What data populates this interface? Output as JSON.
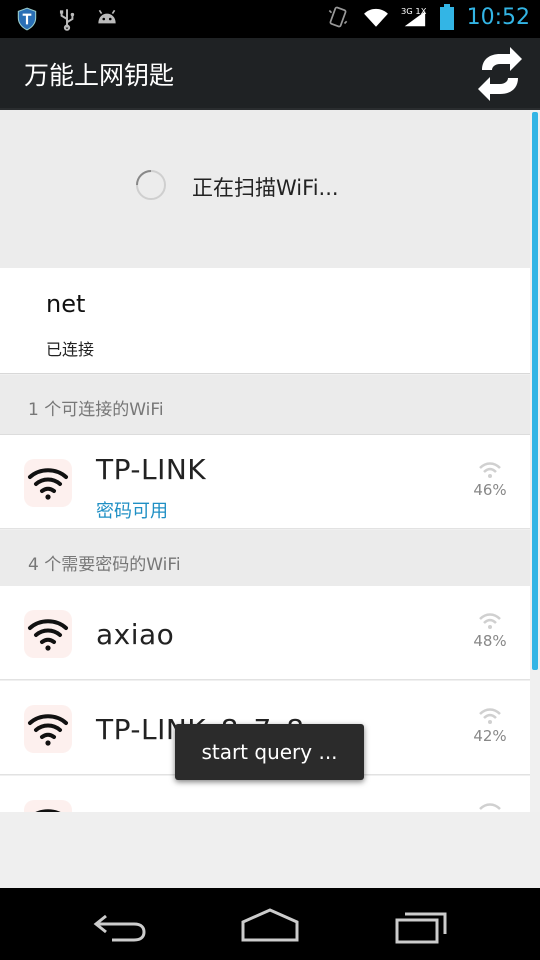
{
  "status_bar": {
    "time": "10:52",
    "icons_left": [
      "shield-icon",
      "usb-icon",
      "android-icon"
    ],
    "icons_right": [
      "vibrate-icon",
      "wifi-signal-icon",
      "cell-signal-3g-icon",
      "battery-icon"
    ],
    "network_label": "3G 1X"
  },
  "app_bar": {
    "title": "万能上网钥匙",
    "refresh_icon": "refresh-icon"
  },
  "scanning": {
    "text": "正在扫描WiFi..."
  },
  "connected": {
    "name": "net",
    "status": "已连接"
  },
  "sections": [
    {
      "label": "1 个可连接的WiFi"
    },
    {
      "label": "4 个需要密码的WiFi"
    }
  ],
  "available_networks": [
    {
      "name": "TP-LINK",
      "subtitle": "密码可用",
      "signal": "46%"
    }
  ],
  "password_networks": [
    {
      "name": "axiao",
      "signal": "48%"
    },
    {
      "name": "TP-LINK_8_7_8",
      "signal": "42%"
    }
  ],
  "toast": {
    "text": "start query ..."
  },
  "colors": {
    "accent": "#33b5e5",
    "link": "#1f8fc4",
    "action_bar": "#1f2224"
  }
}
